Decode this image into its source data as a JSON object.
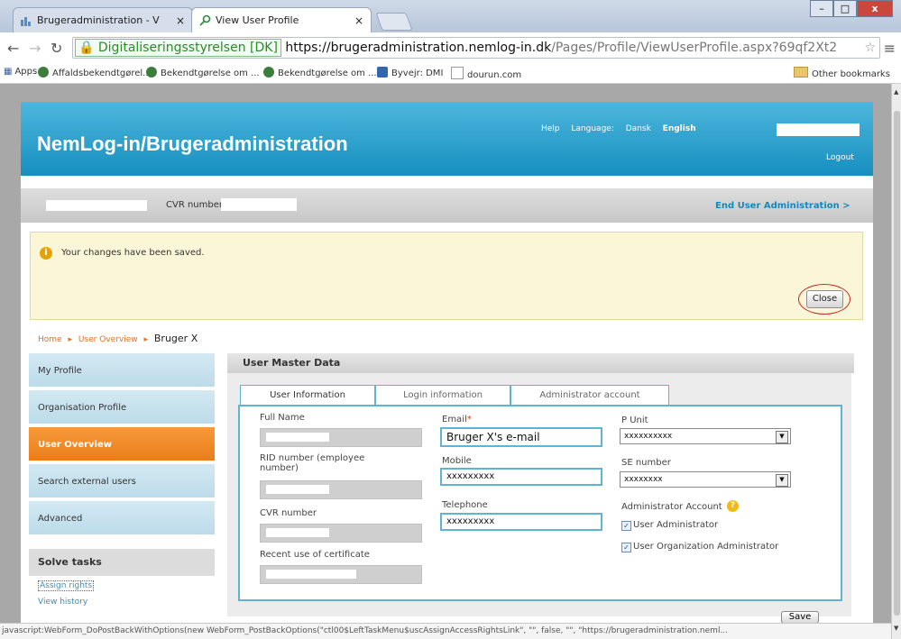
{
  "browser": {
    "tabs": [
      {
        "title": "Brugeradministration - V"
      },
      {
        "title": "View User Profile"
      }
    ],
    "tab_close": "×",
    "window_controls": {
      "minimize": "–",
      "maximize": "□",
      "close": "x"
    },
    "site_badge": "Digitaliseringsstyrelsen [DK]",
    "url_host": "https://brugeradministration.nemlog-in.dk",
    "url_path": "/Pages/Profile/ViewUserProfile.aspx?69qf2Xt2",
    "bookmarks": {
      "apps": "Apps",
      "items": [
        "Affaldsbekendtgørel...",
        "Bekendtgørelse om ...",
        "Bekendtgørelse om ...",
        "Byvejr: DMI",
        "dourun.com"
      ],
      "other": "Other bookmarks"
    },
    "status_text": "javascript:WebForm_DoPostBackWithOptions(new WebForm_PostBackOptions(\"ctl00$LeftTaskMenu$uscAssignAccessRightsLink\", \"\", false, \"\", \"https://brugeradministration.neml..."
  },
  "header": {
    "title": "NemLog-in/Brugeradministration",
    "help": "Help",
    "language_label": "Language:",
    "lang_da": "Dansk",
    "lang_en": "English",
    "logout": "Logout"
  },
  "cvr_bar": {
    "cvr_label": "CVR number:",
    "end_admin": "End User Administration >"
  },
  "notice": {
    "icon": "i",
    "text": "Your changes have been saved.",
    "close_label": "Close"
  },
  "breadcrumb": {
    "home": "Home",
    "overview": "User Overview",
    "current": "Bruger X"
  },
  "sidebar": {
    "items": [
      {
        "label": "My Profile"
      },
      {
        "label": "Organisation Profile"
      },
      {
        "label": "User Overview"
      },
      {
        "label": "Search external users"
      },
      {
        "label": "Advanced"
      }
    ],
    "solve_title": "Solve tasks",
    "assign_rights": "Assign rights",
    "view_history": "View history"
  },
  "main": {
    "section_title": "User Master Data",
    "tabs": [
      "User Information",
      "Login information",
      "Administrator account"
    ],
    "fields": {
      "full_name": "Full Name",
      "rid": "RID number (employee number)",
      "cvr": "CVR number",
      "recent_cert": "Recent use of certificate",
      "email_label": "Email",
      "email_value": "Bruger X's e-mail",
      "mobile_label": "Mobile",
      "mobile_value": "xxxxxxxxx",
      "telephone_label": "Telephone",
      "telephone_value": "xxxxxxxxx",
      "punit_label": "P Unit",
      "punit_value": "xxxxxxxxxx",
      "se_label": "SE number",
      "se_value": "xxxxxxxx",
      "admin_account_label": "Administrator Account",
      "help": "?",
      "user_admin": "User Administrator",
      "user_org_admin": "User Organization Administrator"
    },
    "save_label": "Save"
  }
}
